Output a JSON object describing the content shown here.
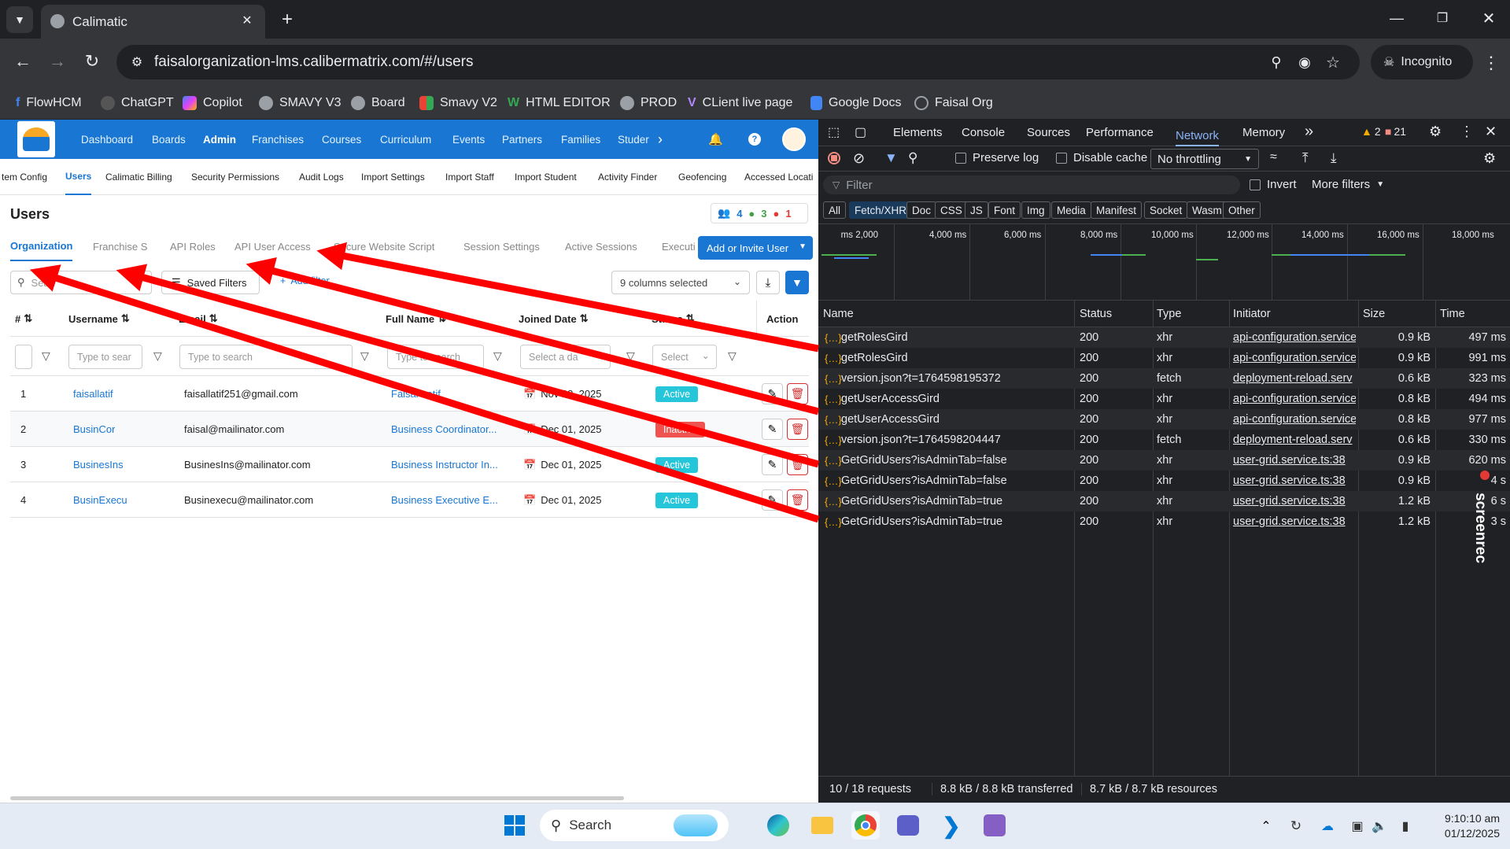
{
  "browser": {
    "tab_title": "Calimatic",
    "url": "faisalorganization-lms.calibermatrix.com/#/users",
    "incognito_label": "Incognito",
    "bookmarks": [
      "FlowHCM",
      "ChatGPT",
      "Copilot",
      "SMAVY V3",
      "Board",
      "Smavy V2",
      "HTML EDITOR",
      "PROD",
      "CLient live page",
      "Google Docs",
      "Faisal Org"
    ]
  },
  "app": {
    "topnav": [
      "Dashboard",
      "Boards",
      "Admin",
      "Franchises",
      "Courses",
      "Curriculum",
      "Events",
      "Partners",
      "Families",
      "Studer"
    ],
    "topnav_active": "Admin",
    "subnav": [
      "tem Config",
      "Users",
      "Calimatic Billing",
      "Security Permissions",
      "Audit Logs",
      "Import Settings",
      "Import Staff",
      "Import Student",
      "Activity Finder",
      "Geofencing",
      "Accessed Locati"
    ],
    "subnav_active": "Users",
    "page_title": "Users",
    "counts": {
      "total": "4",
      "active": "3",
      "inactive": "1"
    },
    "tabs": [
      "Organization",
      "Franchise S",
      "API Roles",
      "API User Access",
      "Secure Website Script",
      "Session Settings",
      "Active Sessions",
      "Executi"
    ],
    "tab_active": "Organization",
    "invite_button": "Add or Invite User",
    "search_placeholder": "Sea",
    "saved_filters": "Saved Filters",
    "add_filter": "Add filter",
    "columns_selected": "9 columns selected",
    "columns": [
      "#",
      "Username",
      "Email",
      "Full Name",
      "Joined Date",
      "Status",
      "Action"
    ],
    "filter_placeholders": {
      "username": "Type to sear",
      "email": "Type to search",
      "fullname": "Type to search",
      "joined": "Select a da",
      "status": "Select"
    },
    "rows": [
      {
        "num": "1",
        "username": "faisallatif",
        "email": "faisallatif251@gmail.com",
        "fullname": "Faisal Latif",
        "joined": "Nov 28, 2025",
        "status": "Active"
      },
      {
        "num": "2",
        "username": "BusinCor",
        "email": "faisal@mailinator.com",
        "fullname": "Business Coordinator...",
        "joined": "Dec 01, 2025",
        "status": "Inactive"
      },
      {
        "num": "3",
        "username": "BusinesIns",
        "email": "BusinesIns@mailinator.com",
        "fullname": "Business Instructor In...",
        "joined": "Dec 01, 2025",
        "status": "Active"
      },
      {
        "num": "4",
        "username": "BusinExecu",
        "email": "Businexecu@mailinator.com",
        "fullname": "Business Executive E...",
        "joined": "Dec 01, 2025",
        "status": "Active"
      }
    ]
  },
  "devtools": {
    "panels": [
      "Elements",
      "Console",
      "Sources",
      "Performance",
      "Network",
      "Memory"
    ],
    "active_panel": "Network",
    "warnings": "2",
    "errors": "21",
    "preserve_log": "Preserve log",
    "disable_cache": "Disable cache",
    "throttling": "No throttling",
    "filter_placeholder": "Filter",
    "invert": "Invert",
    "more_filters": "More filters",
    "type_filters": [
      "All",
      "Fetch/XHR",
      "Doc",
      "CSS",
      "JS",
      "Font",
      "Img",
      "Media",
      "Manifest",
      "Socket",
      "Wasm",
      "Other"
    ],
    "timeline_ticks": [
      "2,000 ms",
      "4,000 ms",
      "6,000 ms",
      "8,000 ms",
      "10,000 ms",
      "12,000 ms",
      "14,000 ms",
      "16,000 ms",
      "18,000 ms"
    ],
    "headers": [
      "Name",
      "Status",
      "Type",
      "Initiator",
      "Size",
      "Time"
    ],
    "requests": [
      {
        "name": "getRolesGird",
        "status": "200",
        "type": "xhr",
        "initiator": "api-configuration.service",
        "size": "0.9 kB",
        "time": "497 ms"
      },
      {
        "name": "getRolesGird",
        "status": "200",
        "type": "xhr",
        "initiator": "api-configuration.service",
        "size": "0.9 kB",
        "time": "991 ms"
      },
      {
        "name": "version.json?t=1764598195372",
        "status": "200",
        "type": "fetch",
        "initiator": "deployment-reload.serv",
        "size": "0.6 kB",
        "time": "323 ms"
      },
      {
        "name": "getUserAccessGird",
        "status": "200",
        "type": "xhr",
        "initiator": "api-configuration.service",
        "size": "0.8 kB",
        "time": "494 ms"
      },
      {
        "name": "getUserAccessGird",
        "status": "200",
        "type": "xhr",
        "initiator": "api-configuration.service",
        "size": "0.8 kB",
        "time": "977 ms"
      },
      {
        "name": "version.json?t=1764598204447",
        "status": "200",
        "type": "fetch",
        "initiator": "deployment-reload.serv",
        "size": "0.6 kB",
        "time": "330 ms"
      },
      {
        "name": "GetGridUsers?isAdminTab=false",
        "status": "200",
        "type": "xhr",
        "initiator": "user-grid.service.ts:38",
        "size": "0.9 kB",
        "time": "620 ms"
      },
      {
        "name": "GetGridUsers?isAdminTab=false",
        "status": "200",
        "type": "xhr",
        "initiator": "user-grid.service.ts:38",
        "size": "0.9 kB",
        "time": "4 s"
      },
      {
        "name": "GetGridUsers?isAdminTab=true",
        "status": "200",
        "type": "xhr",
        "initiator": "user-grid.service.ts:38",
        "size": "1.2 kB",
        "time": "6 s"
      },
      {
        "name": "GetGridUsers?isAdminTab=true",
        "status": "200",
        "type": "xhr",
        "initiator": "user-grid.service.ts:38",
        "size": "1.2 kB",
        "time": "3 s"
      }
    ],
    "summary": [
      "10 / 18 requests",
      "8.8 kB / 8.8 kB transferred",
      "8.7 kB / 8.7 kB resources"
    ],
    "watermark": "screenrec"
  },
  "taskbar": {
    "search_label": "Search",
    "time": "9:10:10 am",
    "date": "01/12/2025"
  },
  "colors": {
    "accent": "#1976d2",
    "annotation": "#ff0000",
    "active_badge": "#26c6da",
    "inactive_badge": "#ef5350"
  }
}
